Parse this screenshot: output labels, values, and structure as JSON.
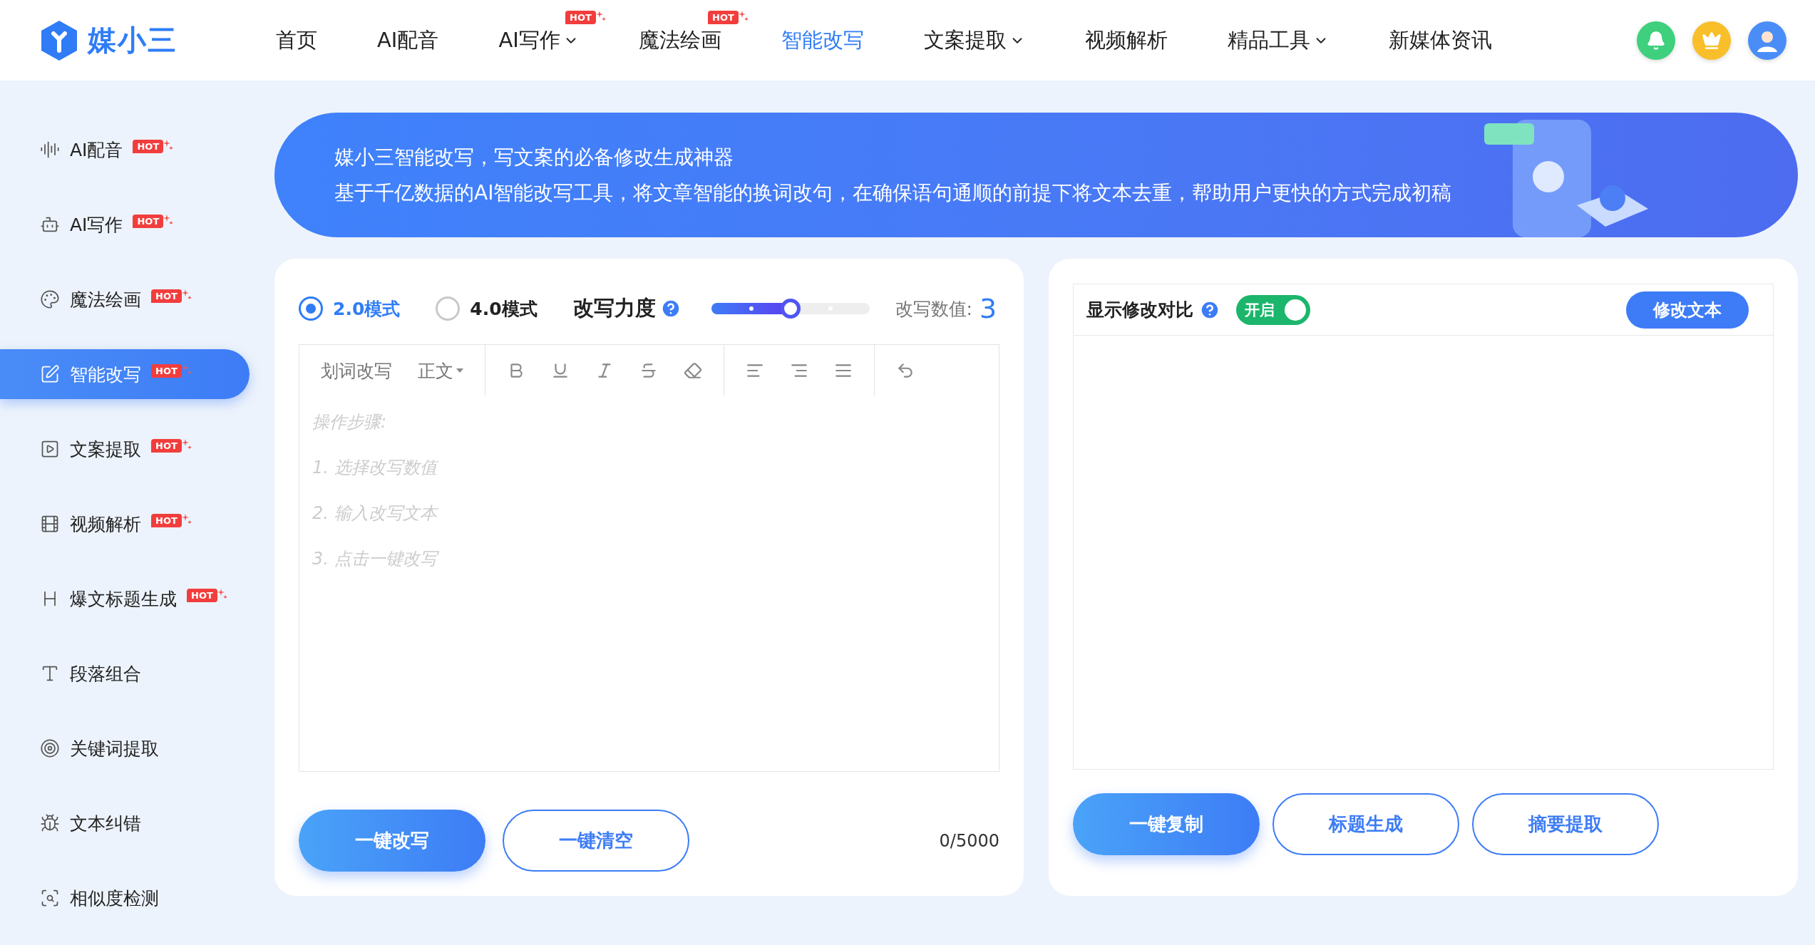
{
  "logo": {
    "text": "媒小三"
  },
  "nav": [
    {
      "label": "首页",
      "selected": false,
      "dropdown": false
    },
    {
      "label": "AI配音",
      "selected": false,
      "dropdown": false
    },
    {
      "label": "AI写作",
      "selected": false,
      "dropdown": true,
      "badge": "HOT"
    },
    {
      "label": "魔法绘画",
      "selected": false,
      "dropdown": false,
      "badge": "HOT"
    },
    {
      "label": "智能改写",
      "selected": true,
      "dropdown": false
    },
    {
      "label": "文案提取",
      "selected": false,
      "dropdown": true
    },
    {
      "label": "视频解析",
      "selected": false,
      "dropdown": false
    },
    {
      "label": "精品工具",
      "selected": false,
      "dropdown": true
    },
    {
      "label": "新媒体资讯",
      "selected": false,
      "dropdown": false
    }
  ],
  "sidebar": {
    "items": [
      {
        "label": "AI配音",
        "selected": false,
        "badge": "HOT"
      },
      {
        "label": "AI写作",
        "selected": false,
        "badge": "HOT"
      },
      {
        "label": "魔法绘画",
        "selected": false,
        "badge": "HOT"
      },
      {
        "label": "智能改写",
        "selected": true,
        "badge": "HOT"
      },
      {
        "label": "文案提取",
        "selected": false,
        "badge": "HOT"
      },
      {
        "label": "视频解析",
        "selected": false,
        "badge": "HOT"
      },
      {
        "label": "爆文标题生成",
        "selected": false,
        "badge": "HOT"
      },
      {
        "label": "段落组合",
        "selected": false
      },
      {
        "label": "关键词提取",
        "selected": false
      },
      {
        "label": "文本纠错",
        "selected": false
      },
      {
        "label": "相似度检测",
        "selected": false
      }
    ]
  },
  "banner": {
    "title": "媒小三智能改写，写文案的必备修改生成神器",
    "text": "基于千亿数据的AI智能改写工具，将文章智能的换词改句，在确保语句通顺的前提下将文本去重，帮助用户更快的方式完成初稿"
  },
  "editor": {
    "modes": [
      {
        "label": "2.0模式",
        "selected": true
      },
      {
        "label": "4.0模式",
        "selected": false
      }
    ],
    "strength": {
      "label": "改写力度",
      "level": 0.5,
      "reading_label": "改写数值:",
      "reading": "3"
    },
    "toolbar": {
      "rewrite": "划词改写",
      "style": "正文"
    },
    "placeholder": [
      "操作步骤:",
      "1. 选择改写数值",
      "2. 输入改写文本",
      "3. 点击一键改写"
    ],
    "buttons": [
      {
        "label": "一键改写",
        "kind": "primary"
      },
      {
        "label": "一键清空",
        "kind": "outline"
      }
    ],
    "counter": "0/5000"
  },
  "result": {
    "compare_label": "显示修改对比",
    "toggle": {
      "label": "开启",
      "on": true
    },
    "edit_button": "修改文本",
    "buttons": [
      {
        "label": "一键复制",
        "kind": "primary"
      },
      {
        "label": "标题生成",
        "kind": "outline"
      },
      {
        "label": "摘要提取",
        "kind": "outline"
      }
    ]
  }
}
